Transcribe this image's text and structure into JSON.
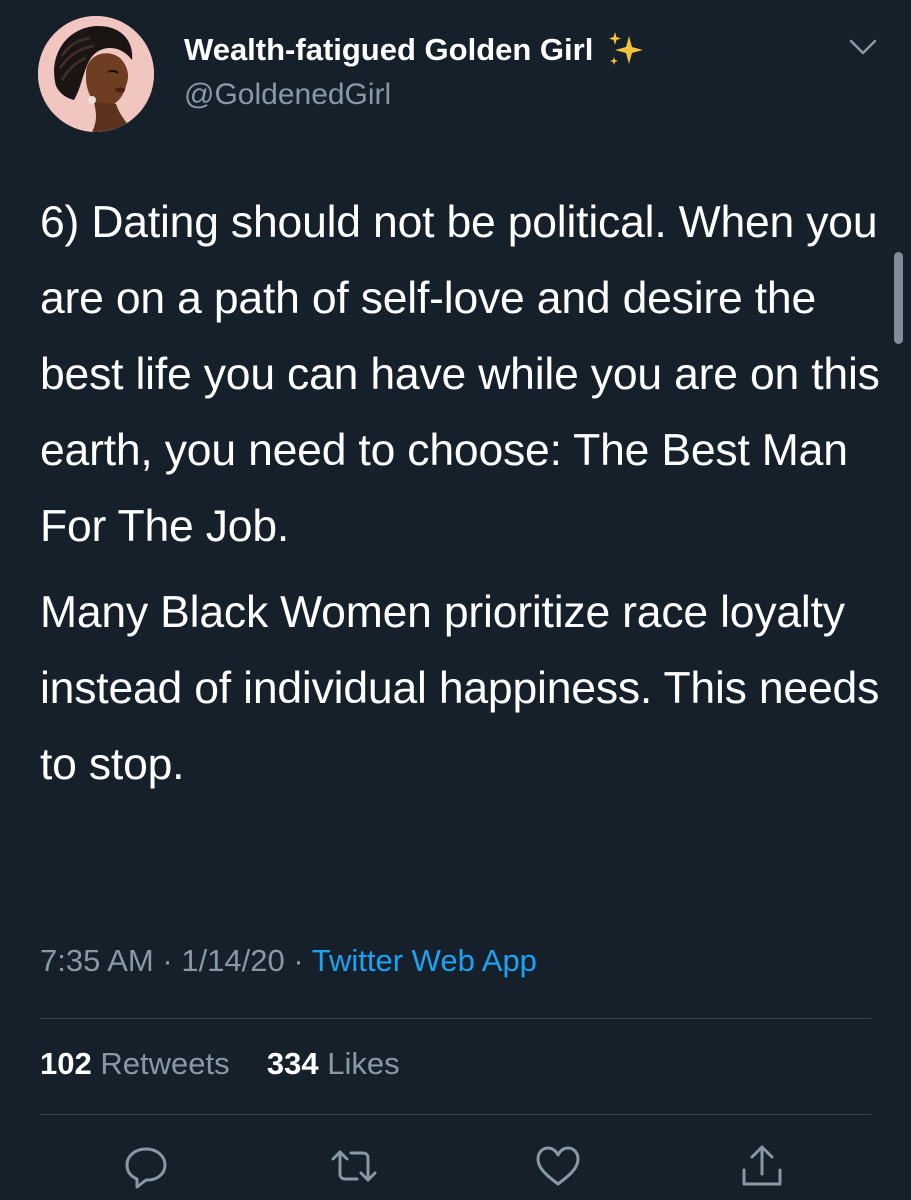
{
  "header": {
    "display_name": "Wealth-fatigued Golden Girl",
    "handle": "@GoldenedGirl",
    "avatar_icon": "portrait-avatar",
    "name_emoji_icon": "sparkles-icon",
    "menu_icon": "chevron-down-icon"
  },
  "tweet": {
    "paragraphs": [
      "6) Dating should not be political. When you are on a path of self-love and desire the best life you can have while you are on this earth, you need to choose: The Best Man For The Job.",
      "Many Black Women prioritize race loyalty instead of individual happiness. This needs to stop."
    ]
  },
  "meta": {
    "time": "7:35 AM",
    "separator": "·",
    "date": "1/14/20",
    "source": "Twitter Web App"
  },
  "stats": {
    "retweets_count": "102",
    "retweets_label": "Retweets",
    "likes_count": "334",
    "likes_label": "Likes"
  },
  "actions": [
    {
      "icon": "reply-icon"
    },
    {
      "icon": "retweet-icon"
    },
    {
      "icon": "like-icon"
    },
    {
      "icon": "share-icon"
    }
  ],
  "colors": {
    "background": "#15202b",
    "text": "#ffffff",
    "secondary_text": "#8899a6",
    "link": "#1da1f2",
    "divider": "#38444d"
  }
}
